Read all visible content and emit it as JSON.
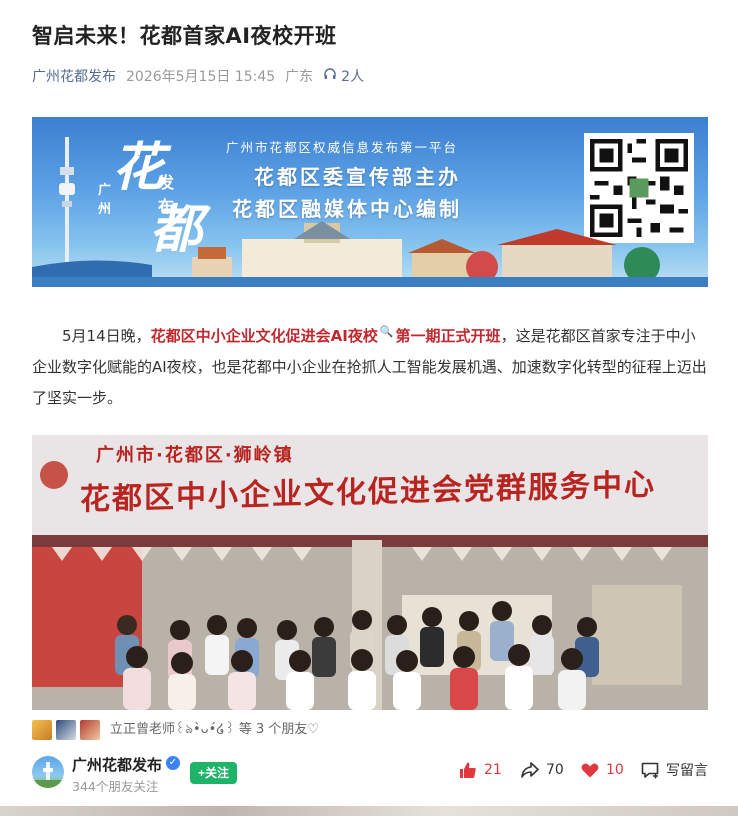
{
  "article": {
    "title": "智启未来！花都首家AI夜校开班",
    "account": "广州花都发布",
    "date": "2026年5月15日 15:45",
    "location": "广东",
    "listeners": "2人"
  },
  "banner": {
    "logo_hua": "花",
    "logo_du": "都",
    "logo_city": "广州",
    "logo_fabu": "发布",
    "tagline": "广州市花都区权威信息发布第一平台",
    "line1": "花都区委宣传部主办",
    "line2": "花都区融媒体中心编制"
  },
  "body": {
    "p1_start": "5月14日晚，",
    "p1_highlight": "花都区中小企业文化促进会AI夜校",
    "p1_search": "🔍",
    "p1_highlight2": "第一期正式开班",
    "p1_rest": "，这是花都区首家专注于中小企业数字化赋能的AI夜校，也是花都中小企业在抢抓人工智能发展机遇、加速数字化转型的征程上迈出了坚实一步。"
  },
  "photo": {
    "sign_small": "广州市·花都区·狮岭镇",
    "sign_big": "花都区中小企业文化促进会党群服务中心"
  },
  "friends": {
    "text": "立正曾老师꒰ঌ•̀ᴗ•́໒꒱ 等 3 个朋友♡"
  },
  "footer": {
    "account_name": "广州花都发布",
    "followers": "344个朋友关注",
    "follow_label": "+关注",
    "likes": "21",
    "shares": "70",
    "favorites": "10",
    "comment_label": "写留言"
  },
  "colors": {
    "link": "#576b95",
    "highlight": "#c0282e",
    "follow_green": "#1fb36a",
    "like_red": "#e0383e"
  }
}
